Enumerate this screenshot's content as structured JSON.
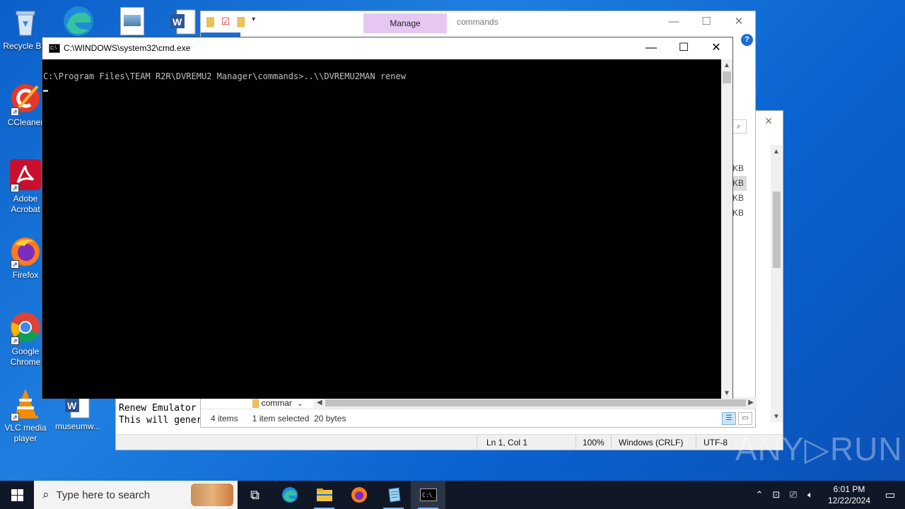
{
  "desktop": {
    "icons": [
      {
        "label": "Recycle Bin",
        "icon": "recycle-bin-icon"
      },
      {
        "label": "CCleaner",
        "icon": "ccleaner-icon"
      },
      {
        "label": "Adobe Acrobat",
        "icon": "adobe-acrobat-icon"
      },
      {
        "label": "Firefox",
        "icon": "firefox-icon"
      },
      {
        "label": "Google Chrome",
        "icon": "chrome-icon"
      },
      {
        "label": "VLC media player",
        "icon": "vlc-icon"
      },
      {
        "label": "museumw...",
        "icon": "word-doc-icon"
      }
    ]
  },
  "explorer": {
    "manage_tab": "Manage",
    "title": "commands",
    "minimize": "—",
    "maximize": "☐",
    "close": "✕",
    "help": "?",
    "tree_item": "commar",
    "sizes": [
      "KB",
      "KB",
      "KB",
      "KB"
    ],
    "status": {
      "items": "4 items",
      "selected": "1 item selected",
      "size": "20 bytes"
    }
  },
  "notepad": {
    "close": "✕",
    "text_lines": [
      "Renew Emulator",
      "This will gener"
    ],
    "status": {
      "position": "Ln 1, Col 1",
      "zoom": "100%",
      "line_ending": "Windows (CRLF)",
      "encoding": "UTF-8"
    }
  },
  "cmd": {
    "title": "C:\\WINDOWS\\system32\\cmd.exe",
    "minimize": "—",
    "maximize": "☐",
    "close": "✕",
    "prompt_line": "C:\\Program Files\\TEAM R2R\\DVREMU2 Manager\\commands>..\\\\DVREMU2MAN renew"
  },
  "watermark": "ANY▷RUN",
  "taskbar": {
    "search_placeholder": "Type here to search",
    "apps": [
      "task-view-icon",
      "edge-icon",
      "file-explorer-icon",
      "firefox-icon",
      "notepad-icon",
      "cmd-icon"
    ],
    "active_app": "cmd-icon",
    "clock": {
      "time": "6:01 PM",
      "date": "12/22/2024"
    }
  },
  "colors": {
    "desktop": "#0b5fc9",
    "taskbar": "#101828",
    "manage_tab": "#e6c7f2",
    "console_bg": "#000000",
    "console_text": "#c0c0c0"
  }
}
